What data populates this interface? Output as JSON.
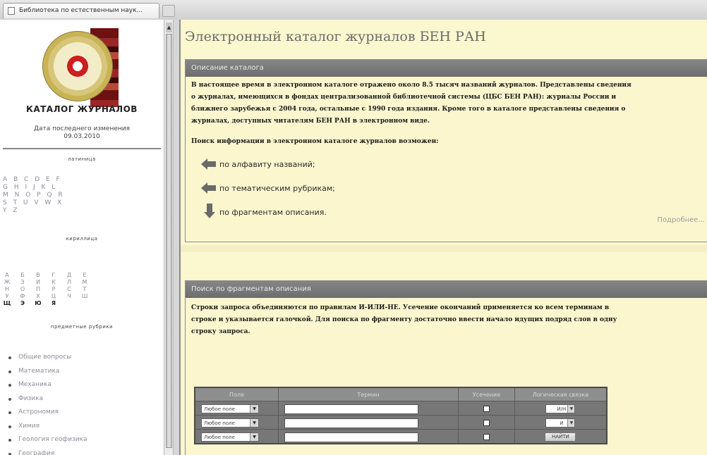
{
  "browser": {
    "tab_title": "Библиотека по естественным наук..."
  },
  "sidebar": {
    "catalog_title": "КАТАЛОГ ЖУРНАЛОВ",
    "last_modified_label": "Дата последнего изменения",
    "last_modified_date": "09.03.2010",
    "latin_label": "латиница",
    "latin_rows": [
      "A B C D E F",
      "G H I J K L",
      "M N O P Q R",
      "S T U V W X",
      "Y Z"
    ],
    "cyrillic_label": "кириллица",
    "cyrillic_rows": [
      [
        "А",
        "Б",
        "В",
        "Г",
        "Д",
        "Е"
      ],
      [
        "Ж",
        "З",
        "И",
        "К",
        "Л",
        "М"
      ],
      [
        "Н",
        "О",
        "П",
        "Р",
        "С",
        "Т"
      ],
      [
        "У",
        "Ф",
        "Х",
        "Ц",
        "Ч",
        "Ш"
      ],
      [
        "Щ",
        "Э",
        "Ю",
        "Я"
      ]
    ],
    "subjects_label": "предметные рубрики",
    "subjects": [
      "Общие вопросы",
      "Математика",
      "Механика",
      "Физика",
      "Астрономия",
      "Химия",
      "Геология геофизика",
      "География"
    ]
  },
  "main": {
    "title": "Электронный каталог журналов БЕН РАН",
    "description": {
      "heading": "Описание каталога",
      "lines": [
        "В настоящее время в электронном каталоге отражено около 8.5 тысяч названий журналов. Представлены сведения",
        "о журналах, имеющихся в фондах централизованной библиотечной системы (ЦБС БЕН РАН): журналы России и",
        "ближнего зарубежья с 2004 года, остальные с 1990 года издания. Кроме того в каталоге представлены сведения о",
        "журналах, доступных читателям БЕН РАН в электронном виде."
      ],
      "search_intro": "Поиск информации в электронном каталоге журналов возможен:",
      "nav": [
        "по алфавиту названий;",
        "по тематическим рубрикам;",
        "по фрагментам описания."
      ],
      "more_link": "Подробнее..."
    },
    "search": {
      "heading": "Поиск по фрагментам описания",
      "lines": [
        "Строки запроса объединяются по правилам И-ИЛИ-НЕ. Усечение окончаний применяется ко всем терминам в",
        "строке и указывается галочкой. Для поиска по фрагменту достаточно ввести начало идущих подряд слов в одну",
        "строку запроса."
      ],
      "columns": [
        "Поле",
        "Термин",
        "Усечение",
        "Логическая связка"
      ],
      "rows": [
        {
          "field": "Любое поле",
          "term": "",
          "logic": "И/Н"
        },
        {
          "field": "Любое поле",
          "term": "",
          "logic": "И"
        },
        {
          "field": "Любое поле",
          "term": ""
        }
      ],
      "find_button": "НАЙТИ"
    }
  }
}
